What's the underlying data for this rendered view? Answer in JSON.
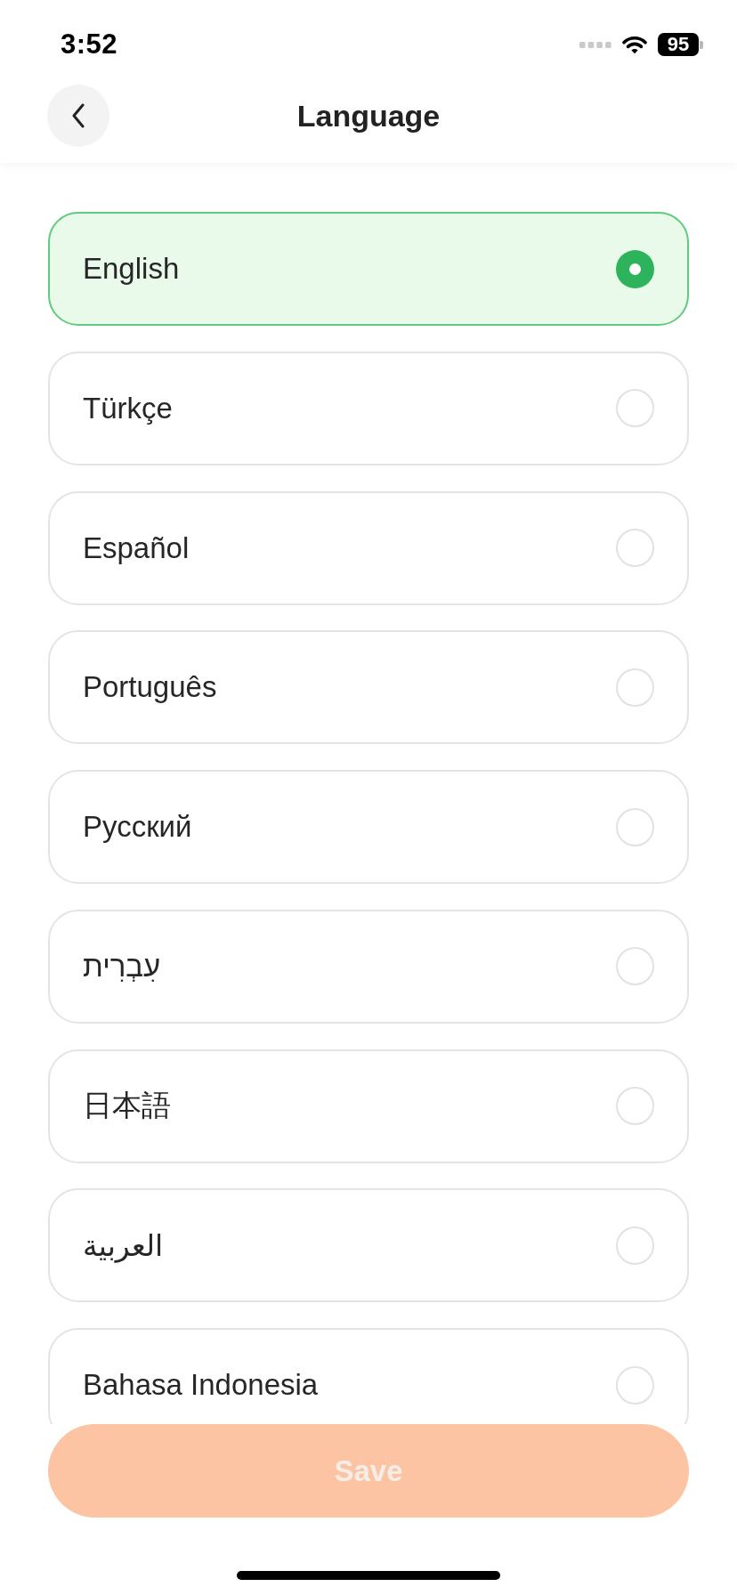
{
  "status_bar": {
    "time": "3:52",
    "battery": "95"
  },
  "header": {
    "title": "Language"
  },
  "languages": [
    {
      "label": "English",
      "selected": true
    },
    {
      "label": "Türkçe",
      "selected": false
    },
    {
      "label": "Español",
      "selected": false
    },
    {
      "label": "Português",
      "selected": false
    },
    {
      "label": "Русский",
      "selected": false
    },
    {
      "label": "עִבְרִית",
      "selected": false
    },
    {
      "label": "日本語",
      "selected": false
    },
    {
      "label": "العربية",
      "selected": false
    },
    {
      "label": "Bahasa Indonesia",
      "selected": false
    }
  ],
  "save_button": {
    "label": "Save",
    "disabled": true
  }
}
